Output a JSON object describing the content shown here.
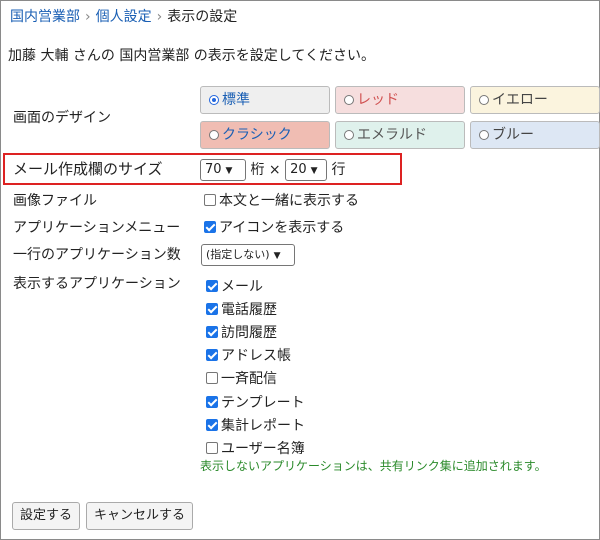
{
  "breadcrumb": {
    "items": [
      "国内営業部",
      "個人設定"
    ],
    "current": "表示の設定",
    "separator": "›"
  },
  "intro_text": "加藤 大輔 さんの 国内営業部 の表示を設定してください。",
  "design": {
    "label": "画面のデザイン",
    "options": [
      {
        "label": "標準",
        "bg": "#efefef",
        "color": "#1a5fb4",
        "selected": true
      },
      {
        "label": "レッド",
        "bg": "#f6dede",
        "color": "#d05050",
        "selected": false
      },
      {
        "label": "イエロー",
        "bg": "#fbf4de",
        "color": "#444444",
        "selected": false
      },
      {
        "label": "クラシック",
        "bg": "#f0bdb3",
        "color": "#1a5fb4",
        "selected": false
      },
      {
        "label": "エメラルド",
        "bg": "#dff1ec",
        "color": "#555555",
        "selected": false
      },
      {
        "label": "ブルー",
        "bg": "#dde7f4",
        "color": "#444444",
        "selected": false
      }
    ]
  },
  "mail_size": {
    "label": "メール作成欄のサイズ",
    "cols_value": "70",
    "cols_unit": "桁",
    "times": "×",
    "rows_value": "20",
    "rows_unit": "行"
  },
  "image_file": {
    "label": "画像ファイル",
    "option_label": "本文と一緒に表示する",
    "checked": false
  },
  "app_menu": {
    "label": "アプリケーションメニュー",
    "option_label": "アイコンを表示する",
    "checked": true
  },
  "apps_per_row": {
    "label": "一行のアプリケーション数",
    "value": "(指定しない)"
  },
  "display_apps": {
    "label": "表示するアプリケーション",
    "items": [
      {
        "label": "メール",
        "checked": true
      },
      {
        "label": "電話履歴",
        "checked": true
      },
      {
        "label": "訪問履歴",
        "checked": true
      },
      {
        "label": "アドレス帳",
        "checked": true
      },
      {
        "label": "一斉配信",
        "checked": false
      },
      {
        "label": "テンプレート",
        "checked": true
      },
      {
        "label": "集計レポート",
        "checked": true
      },
      {
        "label": "ユーザー名簿",
        "checked": false
      }
    ],
    "note": "表示しないアプリケーションは、共有リンク集に追加されます。"
  },
  "buttons": {
    "submit": "設定する",
    "cancel": "キャンセルする"
  }
}
